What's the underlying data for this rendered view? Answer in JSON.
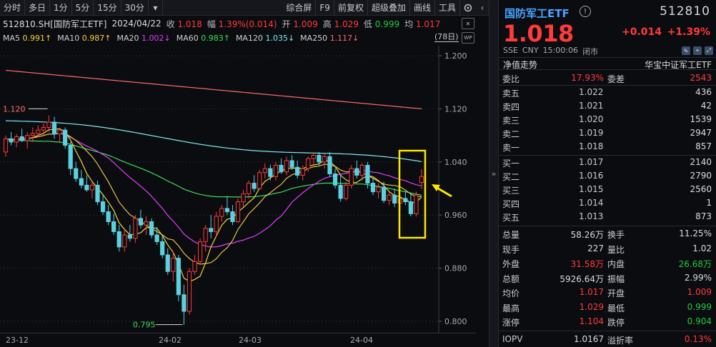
{
  "toolbar": {
    "items": [
      "分时",
      "多日",
      "1分",
      "5分",
      "15分",
      "30分"
    ],
    "right_items": [
      "综合屏",
      "F9",
      "前复权",
      "超级叠加",
      "画线",
      "工具"
    ]
  },
  "info": {
    "symbol": "512810.SH[国防军工ETF]",
    "date": "2024/04/22",
    "close_label": "收",
    "close": "1.018",
    "amp_label": "幅",
    "amp": "1.39%(0.014)",
    "open_label": "开",
    "open": "1.009",
    "high_label": "高",
    "high": "1.029",
    "low_label": "低",
    "low": "0.999",
    "avg_label": "均",
    "avg": "1.017"
  },
  "ma": [
    {
      "label": "MA5",
      "value": "0.991↑",
      "color": "#f5d142"
    },
    {
      "label": "MA10",
      "value": "0.987↑",
      "color": "#f5d142"
    },
    {
      "label": "MA20",
      "value": "1.002↓",
      "color": "#e040fb"
    },
    {
      "label": "MA60",
      "value": "0.983↑",
      "color": "#3ddc5a"
    },
    {
      "label": "MA120",
      "value": "1.035↓",
      "color": "#7fe8f0"
    },
    {
      "label": "MA250",
      "value": "1.117↓",
      "color": "#ff6a6a"
    }
  ],
  "days_label": "(78日)",
  "wp_chip": "WP",
  "chart_data": {
    "type": "candlestick",
    "y_ticks": [
      "1.200",
      "1.120",
      "1.040",
      "0.960",
      "0.880",
      "0.800"
    ],
    "x_labels": [
      "23-12",
      "24-02",
      "24-03",
      "24-04"
    ],
    "annotations": [
      "1.120",
      "0.795"
    ],
    "colors": {
      "up": "#ff3b3b",
      "down": "#5ad1e0",
      "ma5": "#f5d142",
      "ma20": "#e040fb",
      "ma60": "#3ddc5a",
      "ma120": "#7fe8f0",
      "ma250": "#ff6a6a"
    },
    "candles": [
      [
        1.055,
        1.08,
        1.048,
        1.075
      ],
      [
        1.075,
        1.085,
        1.065,
        1.07
      ],
      [
        1.07,
        1.082,
        1.062,
        1.078
      ],
      [
        1.078,
        1.09,
        1.07,
        1.072
      ],
      [
        1.072,
        1.085,
        1.06,
        1.08
      ],
      [
        1.08,
        1.092,
        1.07,
        1.083
      ],
      [
        1.083,
        1.095,
        1.078,
        1.088
      ],
      [
        1.088,
        1.098,
        1.08,
        1.092
      ],
      [
        1.092,
        1.11,
        1.085,
        1.1
      ],
      [
        1.1,
        1.108,
        1.075,
        1.082
      ],
      [
        1.082,
        1.09,
        1.07,
        1.088
      ],
      [
        1.088,
        1.092,
        1.06,
        1.065
      ],
      [
        1.065,
        1.07,
        1.02,
        1.03
      ],
      [
        1.03,
        1.04,
        1.01,
        1.015
      ],
      [
        1.015,
        1.028,
        1.0,
        1.005
      ],
      [
        1.005,
        1.02,
        0.995,
        0.998
      ],
      [
        0.998,
        1.01,
        0.985,
        1.005
      ],
      [
        1.005,
        1.012,
        0.975,
        0.98
      ],
      [
        0.98,
        0.992,
        0.96,
        0.965
      ],
      [
        0.965,
        0.975,
        0.945,
        0.95
      ],
      [
        0.95,
        0.962,
        0.93,
        0.935
      ],
      [
        0.935,
        0.945,
        0.905,
        0.912
      ],
      [
        0.912,
        0.94,
        0.905,
        0.93
      ],
      [
        0.93,
        0.945,
        0.92,
        0.925
      ],
      [
        0.925,
        0.96,
        0.918,
        0.955
      ],
      [
        0.955,
        0.968,
        0.94,
        0.945
      ],
      [
        0.945,
        0.958,
        0.93,
        0.95
      ],
      [
        0.95,
        0.955,
        0.925,
        0.93
      ],
      [
        0.93,
        0.942,
        0.915,
        0.92
      ],
      [
        0.92,
        0.93,
        0.895,
        0.9
      ],
      [
        0.9,
        0.91,
        0.87,
        0.875
      ],
      [
        0.875,
        0.905,
        0.86,
        0.895
      ],
      [
        0.895,
        0.9,
        0.83,
        0.84
      ],
      [
        0.84,
        0.855,
        0.795,
        0.815
      ],
      [
        0.815,
        0.88,
        0.81,
        0.875
      ],
      [
        0.875,
        0.9,
        0.87,
        0.89
      ],
      [
        0.89,
        0.925,
        0.885,
        0.92
      ],
      [
        0.92,
        0.945,
        0.905,
        0.94
      ],
      [
        0.94,
        0.96,
        0.925,
        0.935
      ],
      [
        0.935,
        0.965,
        0.928,
        0.958
      ],
      [
        0.958,
        0.975,
        0.95,
        0.97
      ],
      [
        0.97,
        0.988,
        0.96,
        0.965
      ],
      [
        0.965,
        0.975,
        0.945,
        0.95
      ],
      [
        0.95,
        0.985,
        0.948,
        0.98
      ],
      [
        0.98,
        0.998,
        0.972,
        0.992
      ],
      [
        0.992,
        1.012,
        0.985,
        1.008
      ],
      [
        1.008,
        1.02,
        0.995,
        1.0
      ],
      [
        1.0,
        1.028,
        0.998,
        1.024
      ],
      [
        1.024,
        1.038,
        1.015,
        1.03
      ],
      [
        1.03,
        1.036,
        1.012,
        1.018
      ],
      [
        1.018,
        1.04,
        1.012,
        1.035
      ],
      [
        1.035,
        1.045,
        1.022,
        1.025
      ],
      [
        1.025,
        1.048,
        1.02,
        1.042
      ],
      [
        1.042,
        1.05,
        1.028,
        1.032
      ],
      [
        1.032,
        1.042,
        1.015,
        1.02
      ],
      [
        1.02,
        1.035,
        1.012,
        1.03
      ],
      [
        1.03,
        1.048,
        1.025,
        1.045
      ],
      [
        1.045,
        1.055,
        1.035,
        1.05
      ],
      [
        1.05,
        1.055,
        1.035,
        1.04
      ],
      [
        1.04,
        1.052,
        1.03,
        1.048
      ],
      [
        1.048,
        1.055,
        1.018,
        1.022
      ],
      [
        1.022,
        1.03,
        1.0,
        1.005
      ],
      [
        1.005,
        1.02,
        0.98,
        0.985
      ],
      [
        0.985,
        1.01,
        0.982,
        1.005
      ],
      [
        1.005,
        1.035,
        1.0,
        1.03
      ],
      [
        1.03,
        1.042,
        1.015,
        1.02
      ],
      [
        1.02,
        1.038,
        1.012,
        1.035
      ],
      [
        1.035,
        1.04,
        1.0,
        1.008
      ],
      [
        1.008,
        1.015,
        0.99,
        0.995
      ],
      [
        0.995,
        1.008,
        0.985,
        1.002
      ],
      [
        1.002,
        1.01,
        0.978,
        0.982
      ],
      [
        0.982,
        0.995,
        0.975,
        0.99
      ],
      [
        0.99,
        1.0,
        0.972,
        0.978
      ],
      [
        0.978,
        0.99,
        0.968,
        0.985
      ],
      [
        0.985,
        0.995,
        0.975,
        0.98
      ],
      [
        0.98,
        0.992,
        0.958,
        0.962
      ],
      [
        0.962,
        0.995,
        0.958,
        0.99
      ],
      [
        1.009,
        1.029,
        0.999,
        1.018
      ]
    ]
  },
  "panel": {
    "name": "国防军工ETF",
    "info_icon": "!",
    "code": "512810",
    "price": "1.018",
    "change": "+0.014",
    "change_pct": "+1.39%",
    "meta": [
      "SSE",
      "CNY",
      "15:00:06",
      "闭市"
    ],
    "tab_left": "净值走势",
    "tab_right": "华宝中证军工ETF",
    "weibi_label": "委比",
    "weibi": "17.93%",
    "weicha_label": "委差",
    "weicha": "2543",
    "asks": [
      {
        "label": "卖五",
        "price": "1.022",
        "vol": "436"
      },
      {
        "label": "卖四",
        "price": "1.021",
        "vol": "42"
      },
      {
        "label": "卖三",
        "price": "1.020",
        "vol": "1539"
      },
      {
        "label": "卖二",
        "price": "1.019",
        "vol": "2947"
      },
      {
        "label": "卖一",
        "price": "1.018",
        "vol": "857"
      }
    ],
    "bids": [
      {
        "label": "买一",
        "price": "1.017",
        "vol": "2140"
      },
      {
        "label": "买二",
        "price": "1.016",
        "vol": "2790"
      },
      {
        "label": "买三",
        "price": "1.015",
        "vol": "2560"
      },
      {
        "label": "买四",
        "price": "1.014",
        "vol": "1"
      },
      {
        "label": "买五",
        "price": "1.013",
        "vol": "873"
      }
    ],
    "stats": [
      {
        "l1": "总量",
        "v1": "58.26万",
        "c1": "wht",
        "l2": "换手",
        "v2": "11.25%",
        "c2": "wht"
      },
      {
        "l1": "现手",
        "v1": "227",
        "c1": "wht",
        "l2": "量比",
        "v2": "1.02",
        "c2": "wht"
      },
      {
        "l1": "外盘",
        "v1": "31.58万",
        "c1": "red",
        "l2": "内盘",
        "v2": "26.68万",
        "c2": "green"
      },
      {
        "l1": "总额",
        "v1": "5926.64万",
        "c1": "wht",
        "l2": "振幅",
        "v2": "2.99%",
        "c2": "wht"
      },
      {
        "l1": "均价",
        "v1": "1.017",
        "c1": "red",
        "l2": "开盘",
        "v2": "1.009",
        "c2": "red"
      },
      {
        "l1": "最高",
        "v1": "1.029",
        "c1": "red",
        "l2": "最低",
        "v2": "0.999",
        "c2": "green"
      },
      {
        "l1": "涨停",
        "v1": "1.104",
        "c1": "red",
        "l2": "跌停",
        "v2": "0.904",
        "c2": "green"
      },
      {
        "l1": "IOPV",
        "v1": "1.0167",
        "c1": "wht",
        "l2": "溢折率",
        "v2": "0.13%",
        "c2": "red"
      }
    ]
  }
}
